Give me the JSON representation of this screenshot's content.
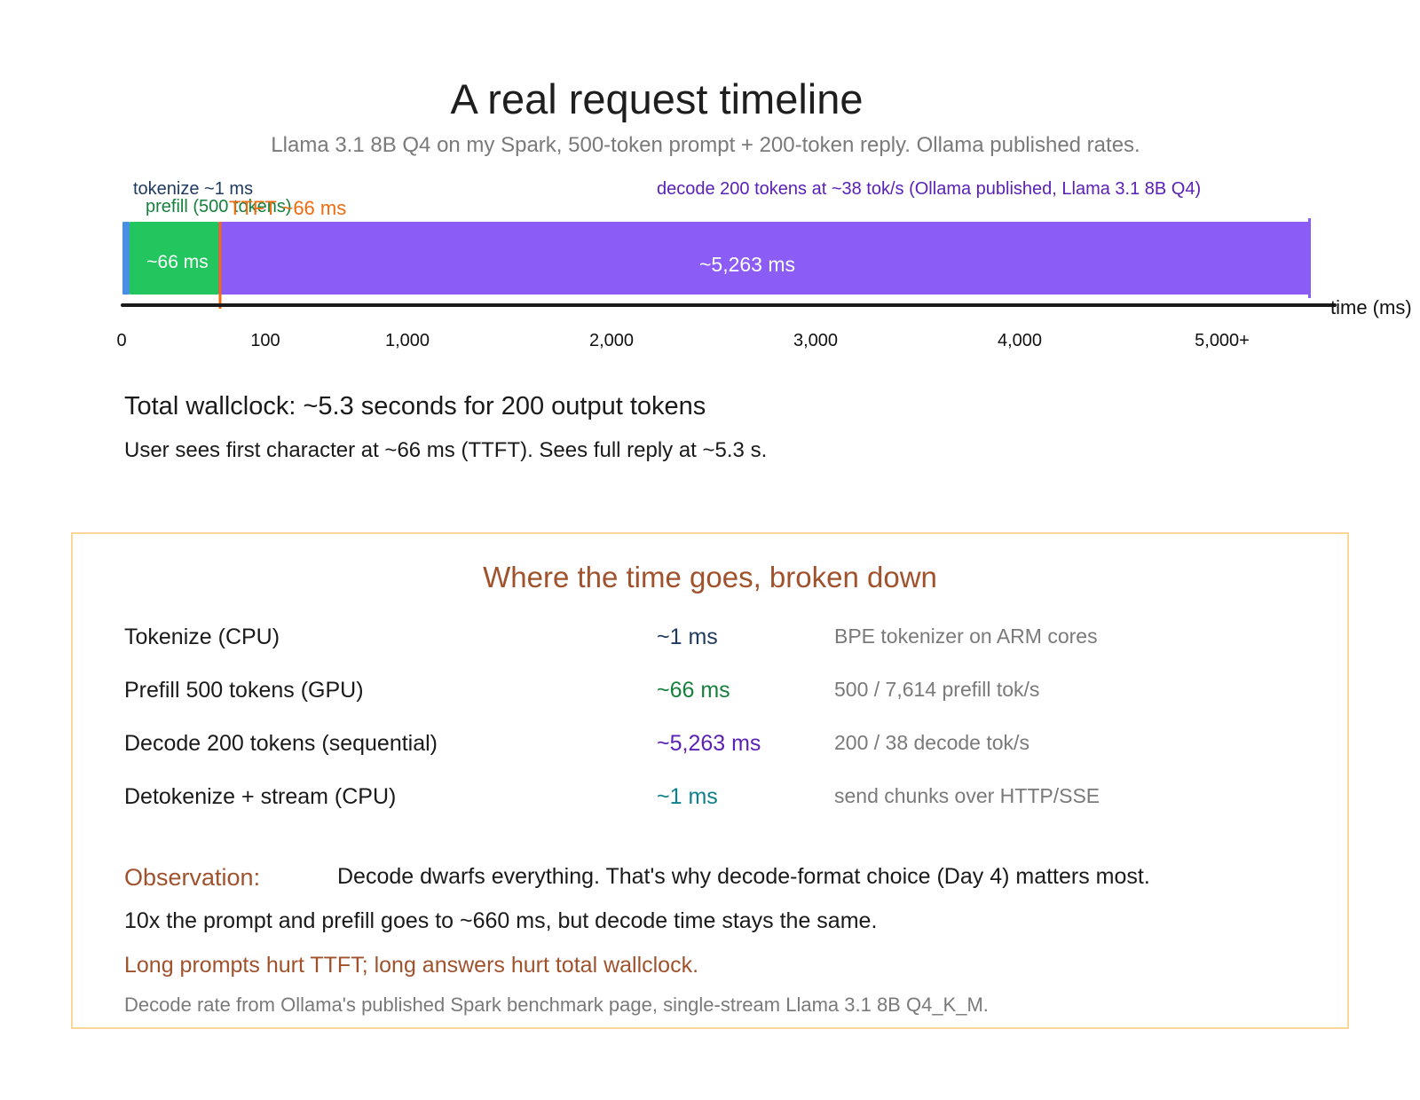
{
  "header": {
    "title": "A real request timeline",
    "subtitle": "Llama 3.1 8B Q4 on my Spark, 500-token prompt + 200-token reply. Ollama published rates."
  },
  "timeline": {
    "labels": {
      "tokenize": "tokenize ~1 ms",
      "prefill": "prefill (500 tokens)",
      "ttft": "TTFT ~66 ms",
      "decode": "decode 200 tokens at ~38 tok/s (Ollama published, Llama 3.1 8B Q4)"
    },
    "bar_values": {
      "prefill": "~66 ms",
      "decode": "~5,263 ms"
    },
    "ticks": [
      "0",
      "100",
      "1,000",
      "2,000",
      "3,000",
      "4,000",
      "5,000+"
    ],
    "axis_label": "time (ms)",
    "colors": {
      "tokenize": "#4a90e2",
      "prefill": "#22c55e",
      "ttft": "#f06a0f",
      "decode": "#8b5cf6",
      "axis": "#1a1a1a"
    }
  },
  "summary": {
    "total": "Total wallclock: ~5.3 seconds for 200 output tokens",
    "user": "User sees first character at ~66 ms (TTFT). Sees full reply at ~5.3 s."
  },
  "breakdown": {
    "title": "Where the time goes, broken down",
    "rows": [
      {
        "name": "Tokenize (CPU)",
        "value": "~1 ms",
        "note": "BPE tokenizer on ARM cores",
        "color": "#1e3a5f"
      },
      {
        "name": "Prefill 500 tokens (GPU)",
        "value": "~66 ms",
        "note": "500 / 7,614 prefill tok/s",
        "color": "#17803d"
      },
      {
        "name": "Decode 200 tokens (sequential)",
        "value": "~5,263 ms",
        "note": "200 / 38 decode tok/s",
        "color": "#5b21b6"
      },
      {
        "name": "Detokenize + stream (CPU)",
        "value": "~1 ms",
        "note": "send chunks over HTTP/SSE",
        "color": "#0e7f8c"
      }
    ],
    "observation_label": "Observation:",
    "observation_text": "Decode dwarfs everything. That's why decode-format choice (Day 4) matters most.",
    "observation_line2": "10x the prompt and prefill goes to ~660 ms, but decode time stays the same.",
    "observation_line3": "Long prompts hurt TTFT; long answers hurt total wallclock.",
    "footnote": "Decode rate from Ollama's published Spark benchmark page, single-stream Llama 3.1 8B Q4_K_M."
  }
}
